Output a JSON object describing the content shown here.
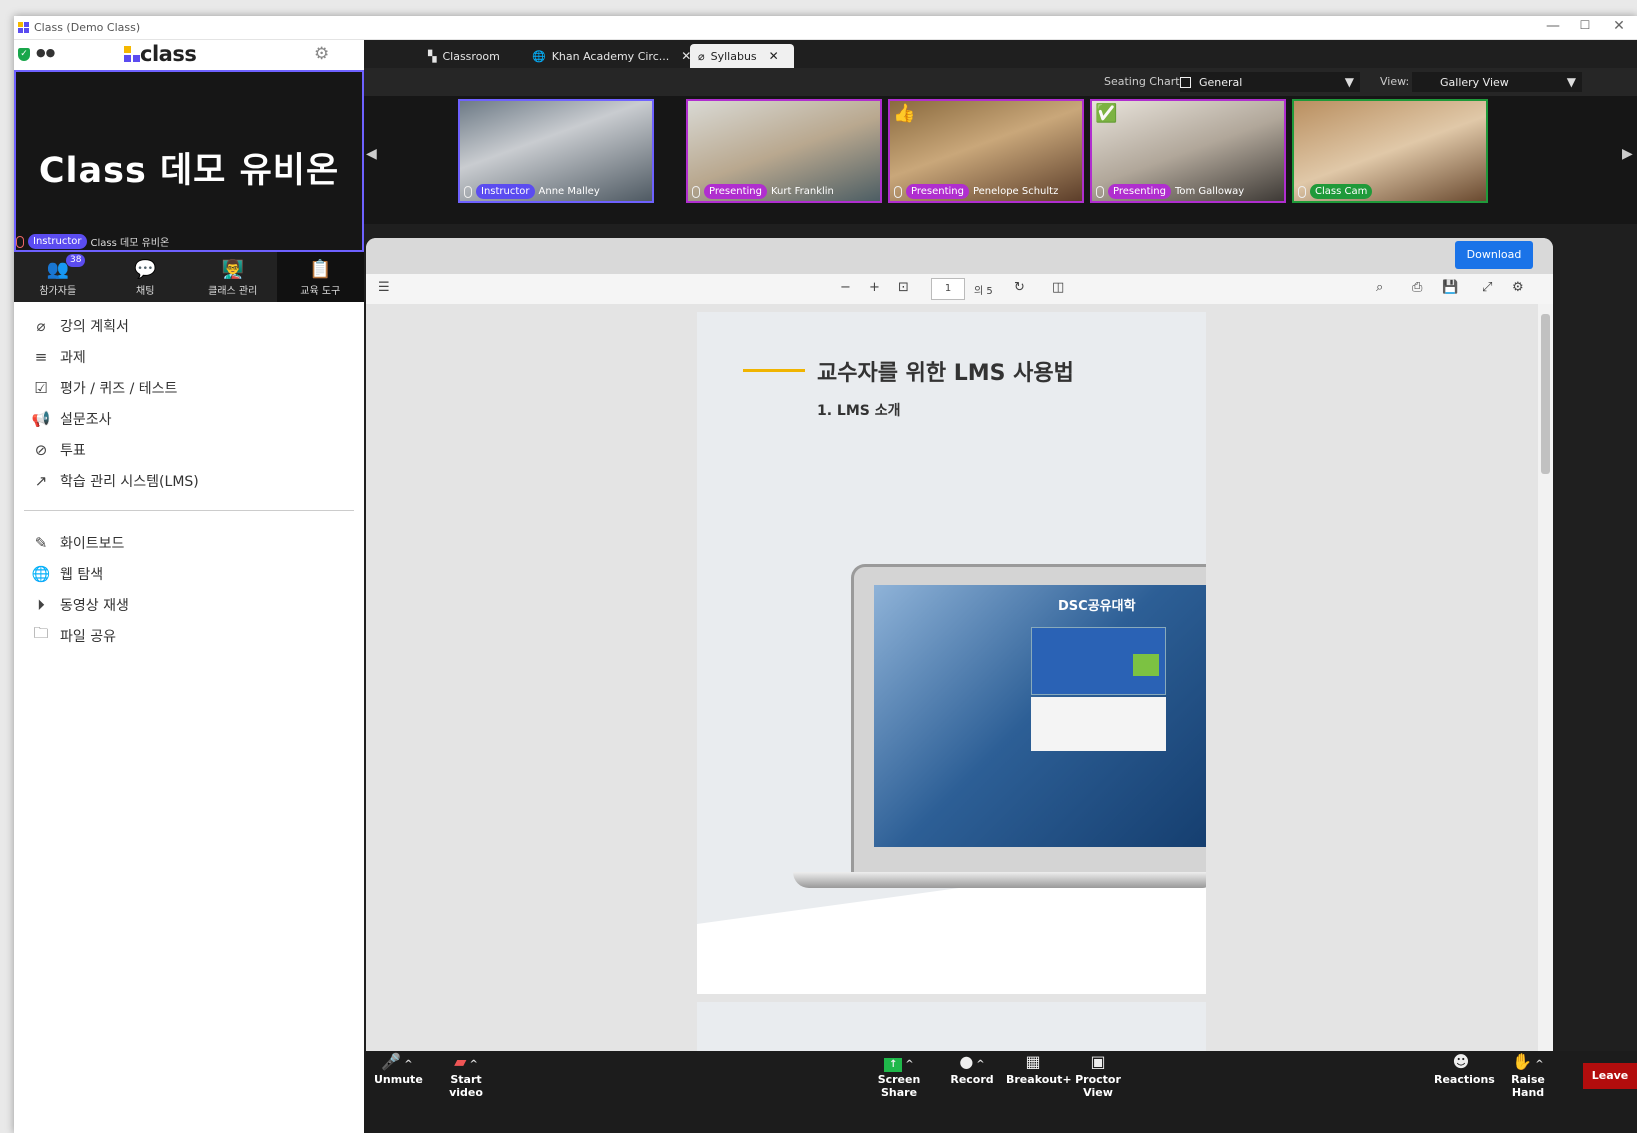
{
  "window": {
    "title": "Class (Demo Class)",
    "minimize": "—",
    "maximize": "☐",
    "close": "✕"
  },
  "sidebar": {
    "logo": "class",
    "self_view": {
      "name": "Class 데모 유비온",
      "badge": "Instructor",
      "caption": "Class 데모 유비온"
    },
    "tabs": [
      {
        "label": "참가자들",
        "icon": "participants-icon",
        "count": "38"
      },
      {
        "label": "채팅",
        "icon": "chat-icon"
      },
      {
        "label": "클래스 관리",
        "icon": "class-management-icon"
      },
      {
        "label": "교육 도구",
        "icon": "teaching-tools-icon",
        "active": true
      }
    ],
    "menu_group1": [
      {
        "label": "강의 계획서",
        "icon": "paperclip-icon"
      },
      {
        "label": "과제",
        "icon": "assignment-list-icon"
      },
      {
        "label": "평가 / 퀴즈 / 테스트",
        "icon": "quiz-check-icon"
      },
      {
        "label": "설문조사",
        "icon": "megaphone-icon"
      },
      {
        "label": "투표",
        "icon": "vote-check-icon"
      },
      {
        "label": "학습 관리 시스템(LMS)",
        "icon": "external-link-icon"
      }
    ],
    "menu_group2": [
      {
        "label": "화이트보드",
        "icon": "whiteboard-icon"
      },
      {
        "label": "웹 탐색",
        "icon": "globe-icon"
      },
      {
        "label": "동영상 재생",
        "icon": "play-circle-icon"
      },
      {
        "label": "파일 공유",
        "icon": "folder-icon"
      }
    ]
  },
  "tabs": {
    "classroom": "Classroom",
    "khan": "Khan Academy Circ...",
    "syllabus": "Syllabus",
    "close": "✕"
  },
  "controls": {
    "seating_label": "Seating Chart:",
    "seating_value": "General",
    "view_label": "View:",
    "view_value": "Gallery View"
  },
  "gallery": [
    {
      "badge": "Instructor",
      "name": "Anne Malley"
    },
    {
      "badge": "Presenting",
      "name": "Kurt Franklin"
    },
    {
      "badge": "Presenting",
      "name": "Penelope Schultz",
      "reaction": "👍"
    },
    {
      "badge": "Presenting",
      "name": "Tom Galloway",
      "reaction": "✅"
    },
    {
      "badge": "Class Cam",
      "name": ""
    }
  ],
  "viewer": {
    "download": "Download",
    "page_current": "1",
    "page_total": "의 5",
    "zoom_out": "−",
    "zoom_in": "+",
    "doc_title": "교수자를 위한 LMS 사용법",
    "doc_subtitle": "1. LMS 소개",
    "screen_brand": "DSC공유대학"
  },
  "bottom": {
    "unmute": "Unmute",
    "start_video": "Start video",
    "screen_share": "Screen Share",
    "record": "Record",
    "breakout": "Breakout+",
    "proctor": "Proctor View",
    "reactions": "Reactions",
    "raise_hand": "Raise Hand",
    "leave": "Leave"
  },
  "colors": {
    "accent": "#6e61ff",
    "presenting": "#b02ecf",
    "classcam": "#1f9a3a",
    "leave": "#b20d0d",
    "download": "#1a73e8"
  }
}
